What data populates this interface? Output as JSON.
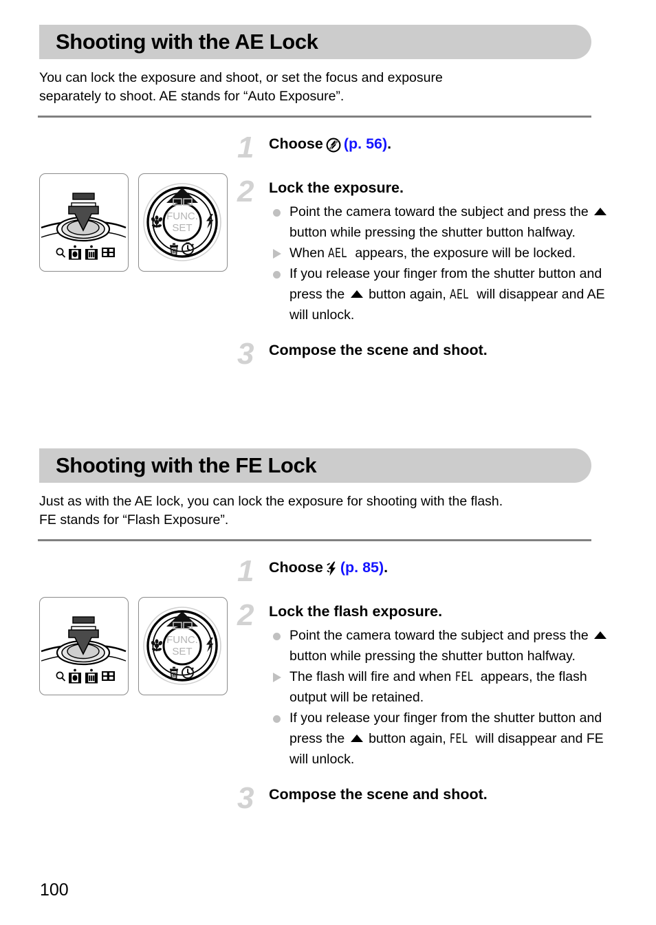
{
  "page": {
    "number": "100"
  },
  "sections": [
    {
      "id": "ae-lock",
      "title": "Shooting with the AE Lock",
      "intro_line1": "You can lock the exposure and shoot, or set the focus and exposure",
      "intro_line2": "separately to shoot. AE stands for “Auto Exposure”.",
      "steps": [
        {
          "number": "1",
          "title_prefix": "Choose",
          "icon": "flash-off-icon",
          "pageref": "(p. 56)",
          "title_suffix": "."
        },
        {
          "number": "2",
          "title": "Lock the exposure.",
          "bullets": [
            {
              "marker": "dot",
              "part1": "Point the camera toward the subject and press the",
              "icon": "up-button-icon",
              "part2": "button while pressing the shutter button halfway."
            },
            {
              "marker": "triangle",
              "part1": "When",
              "tag": "AEL",
              "part2": "appears, the exposure will be locked."
            },
            {
              "marker": "dot",
              "part1": "If you release your finger from the shutter button and press the",
              "icon": "up-button-icon",
              "part2": "button again,",
              "tag": "AEL",
              "part3": "will disappear and AE will unlock."
            }
          ]
        },
        {
          "number": "3",
          "title": "Compose the scene and shoot."
        }
      ],
      "figures": [
        {
          "name": "shutter-button-diagram",
          "caption_icons": [
            "zoom-icon",
            "tele-icon",
            "wide-icon",
            "index-icon"
          ]
        },
        {
          "name": "control-dial-diagram",
          "center_label_line1": "FUNC.",
          "center_label_line2": "SET"
        }
      ]
    },
    {
      "id": "fe-lock",
      "title": "Shooting with the FE Lock",
      "intro_line1": "Just as with the AE lock, you can lock the exposure for shooting with the flash.",
      "intro_line2": "FE stands for “Flash Exposure”.",
      "steps": [
        {
          "number": "1",
          "title_prefix": "Choose",
          "icon": "flash-on-icon",
          "pageref": "(p. 85)",
          "title_suffix": "."
        },
        {
          "number": "2",
          "title": "Lock the flash exposure.",
          "bullets": [
            {
              "marker": "dot",
              "part1": "Point the camera toward the subject and press the",
              "icon": "up-button-icon",
              "part2": "button while pressing the shutter button halfway."
            },
            {
              "marker": "triangle",
              "part1": "The flash will fire and when",
              "tag": "FEL",
              "part2": "appears, the flash output will be retained."
            },
            {
              "marker": "dot",
              "part1": "If you release your finger from the shutter button and press the",
              "icon": "up-button-icon",
              "part2": "button again,",
              "tag": "FEL",
              "part3": "will disappear and FE will unlock."
            }
          ]
        },
        {
          "number": "3",
          "title": "Compose the scene and shoot."
        }
      ],
      "figures": [
        {
          "name": "shutter-button-diagram",
          "caption_icons": [
            "zoom-icon",
            "tele-icon",
            "wide-icon",
            "index-icon"
          ]
        },
        {
          "name": "control-dial-diagram",
          "center_label_line1": "FUNC.",
          "center_label_line2": "SET"
        }
      ]
    }
  ],
  "colors": {
    "header_bar": "#cccccc",
    "rule": "#808080",
    "step_number": "#d2d2d2",
    "pageref_link": "#1414ff",
    "bullet_marker": "#c0c0c0"
  }
}
